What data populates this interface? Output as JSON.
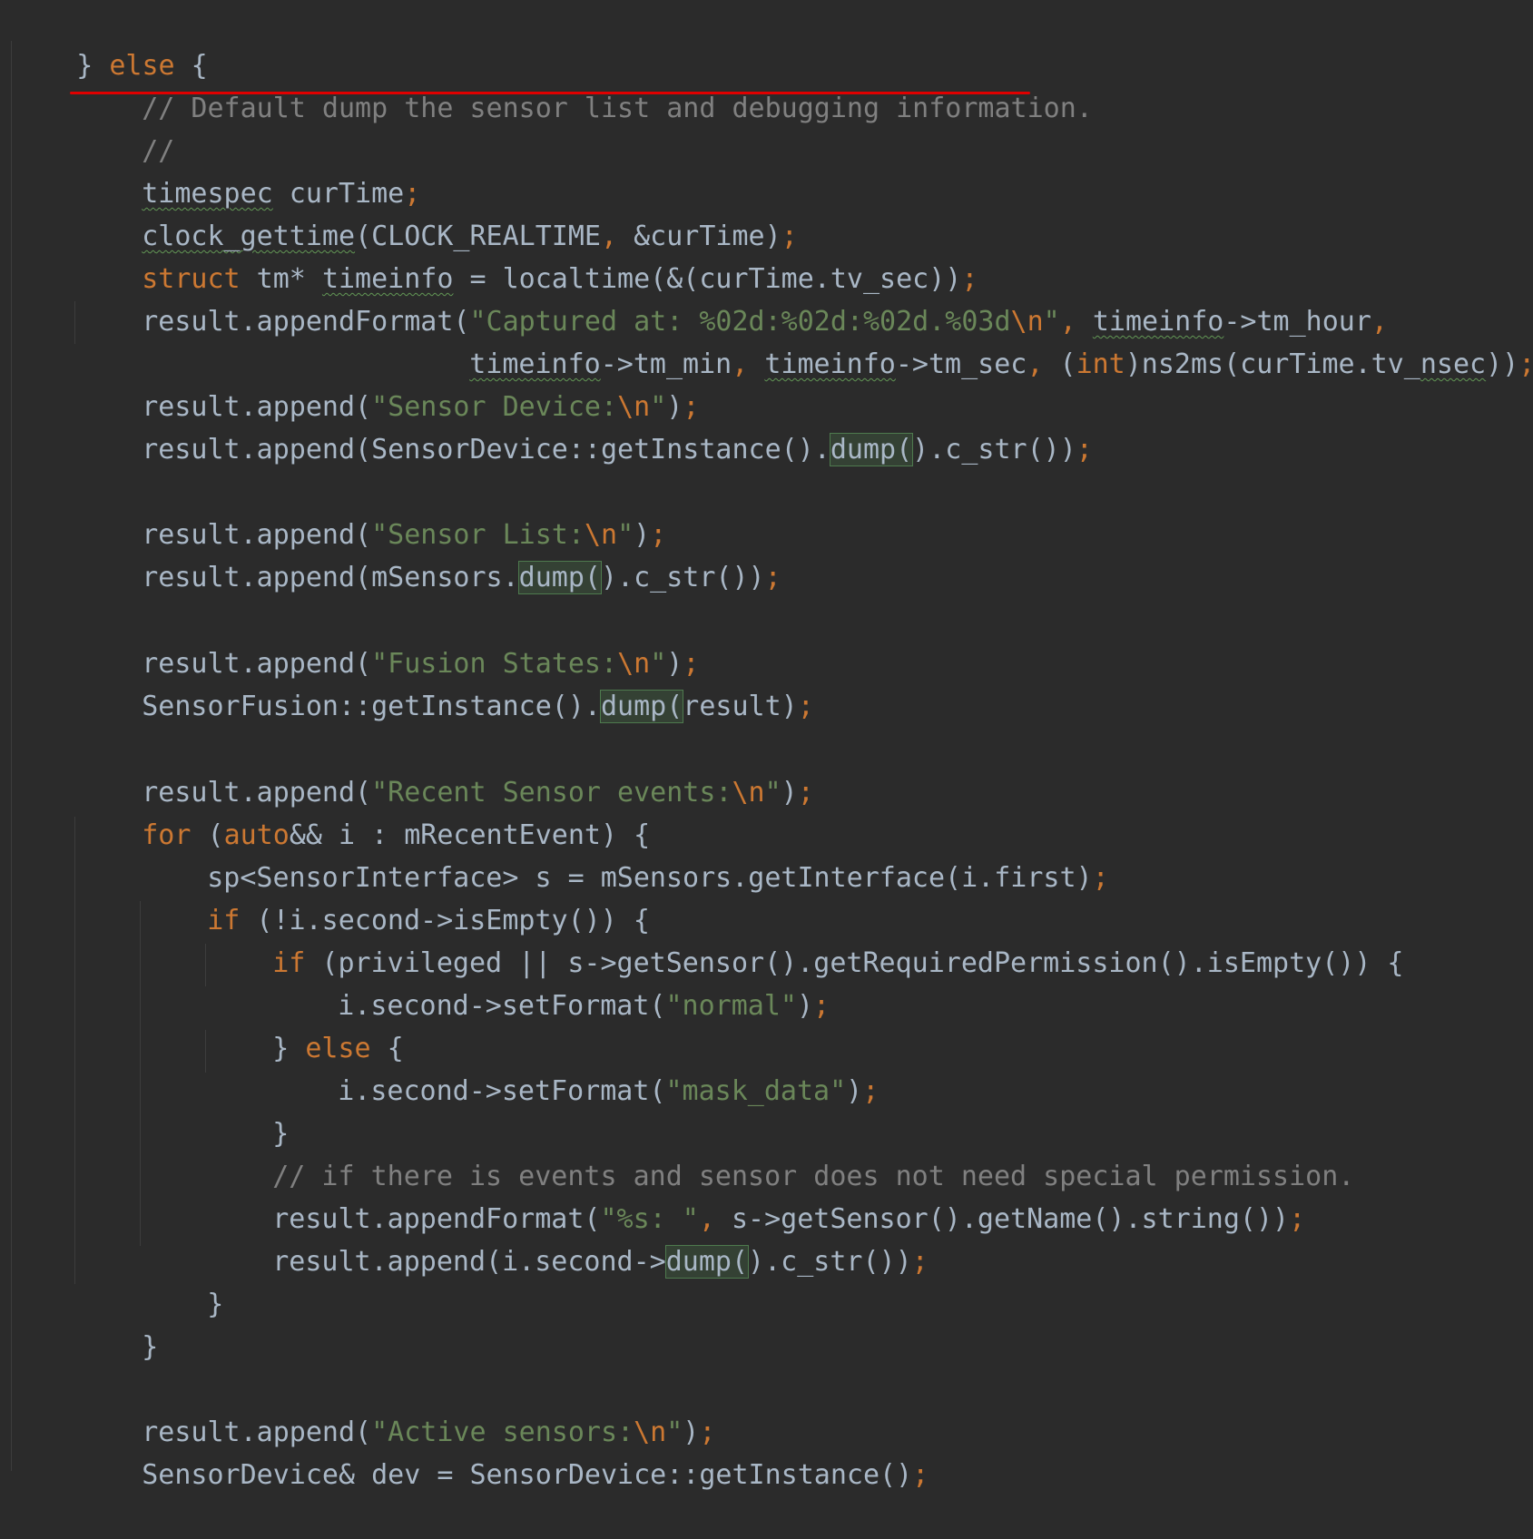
{
  "code": {
    "l1": {
      "a": "} ",
      "else": "else",
      "b": " {"
    },
    "l2": {
      "comment": "// Default dump the sensor list and debugging information."
    },
    "l3": {
      "comment": "//"
    },
    "l4": {
      "type": "timespec",
      "rest": " curTime",
      "semi": ";"
    },
    "l5": {
      "fn": "clock_gettime",
      "a": "(CLOCK_REALTIME",
      "comma": ",",
      "b": " &curTime)",
      "semi": ";"
    },
    "l6": {
      "kw": "struct",
      "a": " tm* ",
      "var": "timeinfo",
      "b": " = localtime(&(curTime.tv_sec))",
      "semi": ";"
    },
    "l7": {
      "a": "result.appendFormat(",
      "str": "\"Captured at: %02d:%02d:%02d.%03d",
      "esc": "\\n",
      "strend": "\"",
      "comma": ",",
      "sp": " ",
      "var": "timeinfo",
      "b": "->tm_hour",
      "comma2": ","
    },
    "l8": {
      "var1": "timeinfo",
      "a": "->tm_min",
      "c1": ",",
      "sp1": " ",
      "var2": "timeinfo",
      "b": "->tm_sec",
      "c2": ",",
      "c": " (",
      "kw": "int",
      "d": ")ns2ms(curTime.tv_",
      "var3": "nsec",
      "e": "))",
      "semi": ";"
    },
    "l9": {
      "a": "result.append(",
      "str": "\"Sensor Device:",
      "esc": "\\n",
      "strend": "\"",
      "b": ")",
      "semi": ";"
    },
    "l10": {
      "a": "result.append(SensorDevice::getInstance().",
      "hl": "dump(",
      "b": ").c_str())",
      "semi": ";"
    },
    "l11": {
      "a": "result.append(",
      "str": "\"Sensor List:",
      "esc": "\\n",
      "strend": "\"",
      "b": ")",
      "semi": ";"
    },
    "l12": {
      "a": "result.append(mSensors.",
      "hl": "dump(",
      "b": ").c_str())",
      "semi": ";"
    },
    "l13": {
      "a": "result.append(",
      "str": "\"Fusion States:",
      "esc": "\\n",
      "strend": "\"",
      "b": ")",
      "semi": ";"
    },
    "l14": {
      "a": "SensorFusion::getInstance().",
      "hl": "dump(",
      "b": "result)",
      "semi": ";"
    },
    "l15": {
      "a": "result.append(",
      "str": "\"Recent Sensor events:",
      "esc": "\\n",
      "strend": "\"",
      "b": ")",
      "semi": ";"
    },
    "l16": {
      "kw": "for",
      "a": " (",
      "kw2": "auto",
      "b": "&& i : mRecentEvent) {"
    },
    "l17": {
      "a": "sp<SensorInterface> s = mSensors.getInterface(i.first)",
      "semi": ";"
    },
    "l18": {
      "kw": "if",
      "a": " (!i.second->isEmpty()) {"
    },
    "l19": {
      "kw": "if",
      "a": " (privileged || s->getSensor().getRequiredPermission().isEmpty()) {"
    },
    "l20": {
      "a": "i.second->setFormat(",
      "str": "\"normal\"",
      "b": ")",
      "semi": ";"
    },
    "l21": {
      "a": "} ",
      "kw": "else",
      "b": " {"
    },
    "l22": {
      "a": "i.second->setFormat(",
      "str": "\"mask_data\"",
      "b": ")",
      "semi": ";"
    },
    "l23": {
      "a": "}"
    },
    "l24": {
      "comment": "// if there is events and sensor does not need special permission."
    },
    "l25": {
      "a": "result.appendFormat(",
      "str": "\"%s: \"",
      "comma": ",",
      "b": " s->getSensor().getName().string())",
      "semi": ";"
    },
    "l26": {
      "a": "result.append(i.second->",
      "hl": "dump(",
      "b": ").c_str())",
      "semi": ";"
    },
    "l27": {
      "a": "}"
    },
    "l28": {
      "a": "}"
    },
    "l29": {
      "a": "result.append(",
      "str": "\"Active sensors:",
      "esc": "\\n",
      "strend": "\"",
      "b": ")",
      "semi": ";"
    },
    "l30": {
      "a": "SensorDevice& dev = SensorDevice::getInstance()",
      "semi": ";"
    }
  },
  "colors": {
    "background": "#2b2b2b",
    "text": "#a9b7c6",
    "keyword": "#cc7832",
    "string": "#6a8759",
    "comment": "#808080",
    "highlight": "#344134",
    "annotation_underline": "#e00000"
  }
}
